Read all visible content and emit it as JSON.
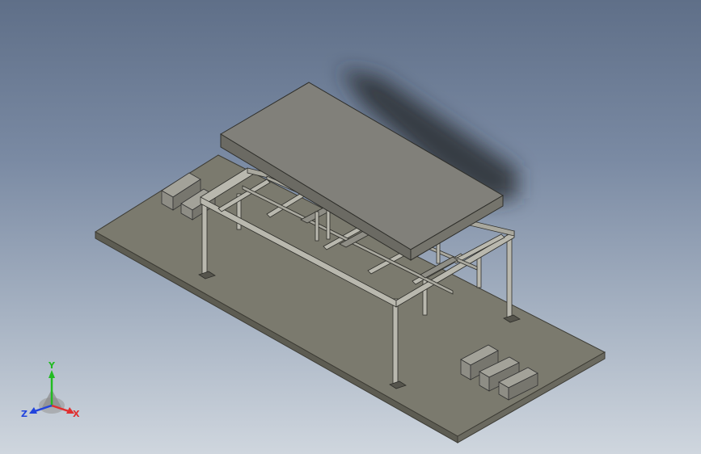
{
  "viewport": {
    "colors": {
      "bg_top": "#5f6f88",
      "bg_bottom": "#cfd6de",
      "base_top": "#7b7a6e",
      "base_edge": "#3d3c35",
      "slab_top": "#81807a",
      "slab_side": "#6b6a63",
      "frame": "#b9b8ae",
      "box": "#8e8d85",
      "shadow": "#2b2d33"
    }
  },
  "triad": {
    "y_label": "Y",
    "x_label": "X",
    "z_label": "Z",
    "colors": {
      "x": "#e03030",
      "y": "#22bb22",
      "z": "#2244dd"
    }
  }
}
